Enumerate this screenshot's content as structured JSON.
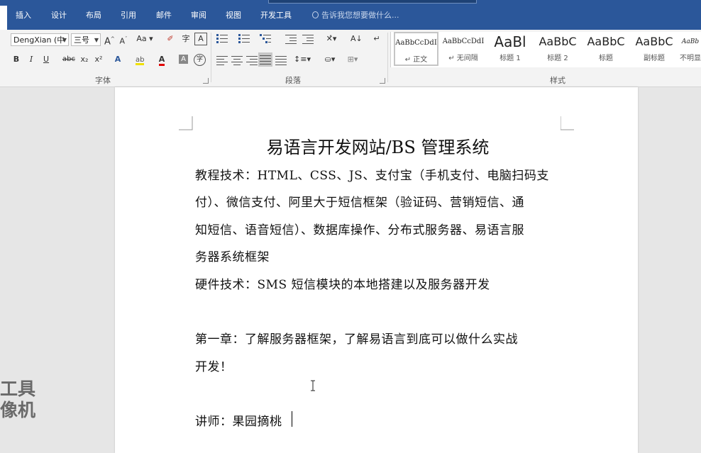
{
  "tabs": [
    "插入",
    "设计",
    "布局",
    "引用",
    "邮件",
    "审阅",
    "视图",
    "开发工具"
  ],
  "tell_me": "告诉我您想要做什么...",
  "font": {
    "name": "DengXian (中",
    "size": "三号",
    "grow": "A",
    "shrink": "A",
    "case": "Aa",
    "bold": "B",
    "italic": "I",
    "underline": "U",
    "strike": "abc",
    "subscript": "x₂",
    "superscript": "x²",
    "group_label": "字体"
  },
  "paragraph": {
    "group_label": "段落"
  },
  "styles": {
    "group_label": "样式",
    "items": [
      {
        "sample": "AaBbCcDdI",
        "name": "↵ 正文"
      },
      {
        "sample": "AaBbCcDdI",
        "name": "↵ 无间隔"
      },
      {
        "sample": "AaBl",
        "name": "标题 1"
      },
      {
        "sample": "AaBbC",
        "name": "标题 2"
      },
      {
        "sample": "AaBbC",
        "name": "标题"
      },
      {
        "sample": "AaBbC",
        "name": "副标题"
      },
      {
        "sample": "AaBb",
        "name": "不明显"
      }
    ]
  },
  "document": {
    "title": "易语言开发网站/BS 管理系统",
    "lines": [
      "教程技术：HTML、CSS、JS、支付宝（手机支付、电脑扫码支",
      "付）、微信支付、阿里大于短信框架（验证码、营销短信、通",
      "知短信、语音短信）、数据库操作、分布式服务器、易语言服",
      "务器系统框架",
      "硬件技术：SMS 短信模块的本地搭建以及服务器开发",
      "第一章：了解服务器框架，了解易语言到底可以做什么实战",
      "开发！",
      "讲师：果园摘桃"
    ]
  },
  "watermark": {
    "line1": "工具",
    "line2": "像机"
  }
}
